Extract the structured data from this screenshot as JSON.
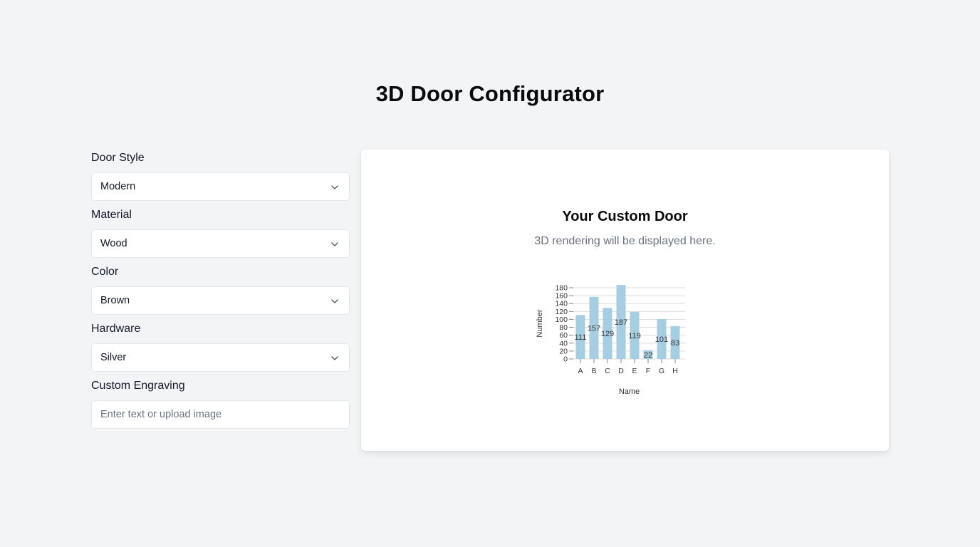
{
  "page": {
    "title": "3D Door Configurator"
  },
  "form": {
    "door_style": {
      "label": "Door Style",
      "value": "Modern"
    },
    "material": {
      "label": "Material",
      "value": "Wood"
    },
    "color": {
      "label": "Color",
      "value": "Brown"
    },
    "hardware": {
      "label": "Hardware",
      "value": "Silver"
    },
    "engraving": {
      "label": "Custom Engraving",
      "placeholder": "Enter text or upload image",
      "value": ""
    }
  },
  "preview": {
    "title": "Your Custom Door",
    "subtitle": "3D rendering will be displayed here."
  },
  "icons": {
    "select_chevron": "chevron-down-icon"
  },
  "colors": {
    "bar_fill": "#a6cee3",
    "page_bg": "#f3f4f6"
  },
  "chart_data": {
    "type": "bar",
    "categories": [
      "A",
      "B",
      "C",
      "D",
      "E",
      "F",
      "G",
      "H"
    ],
    "values": [
      111,
      157,
      129,
      187,
      119,
      22,
      101,
      83
    ],
    "xlabel": "Name",
    "ylabel": "Number",
    "ylim": [
      0,
      180
    ],
    "yticks": [
      0,
      20,
      40,
      60,
      80,
      100,
      120,
      140,
      160,
      180
    ],
    "grid": true,
    "data_labels": true
  }
}
